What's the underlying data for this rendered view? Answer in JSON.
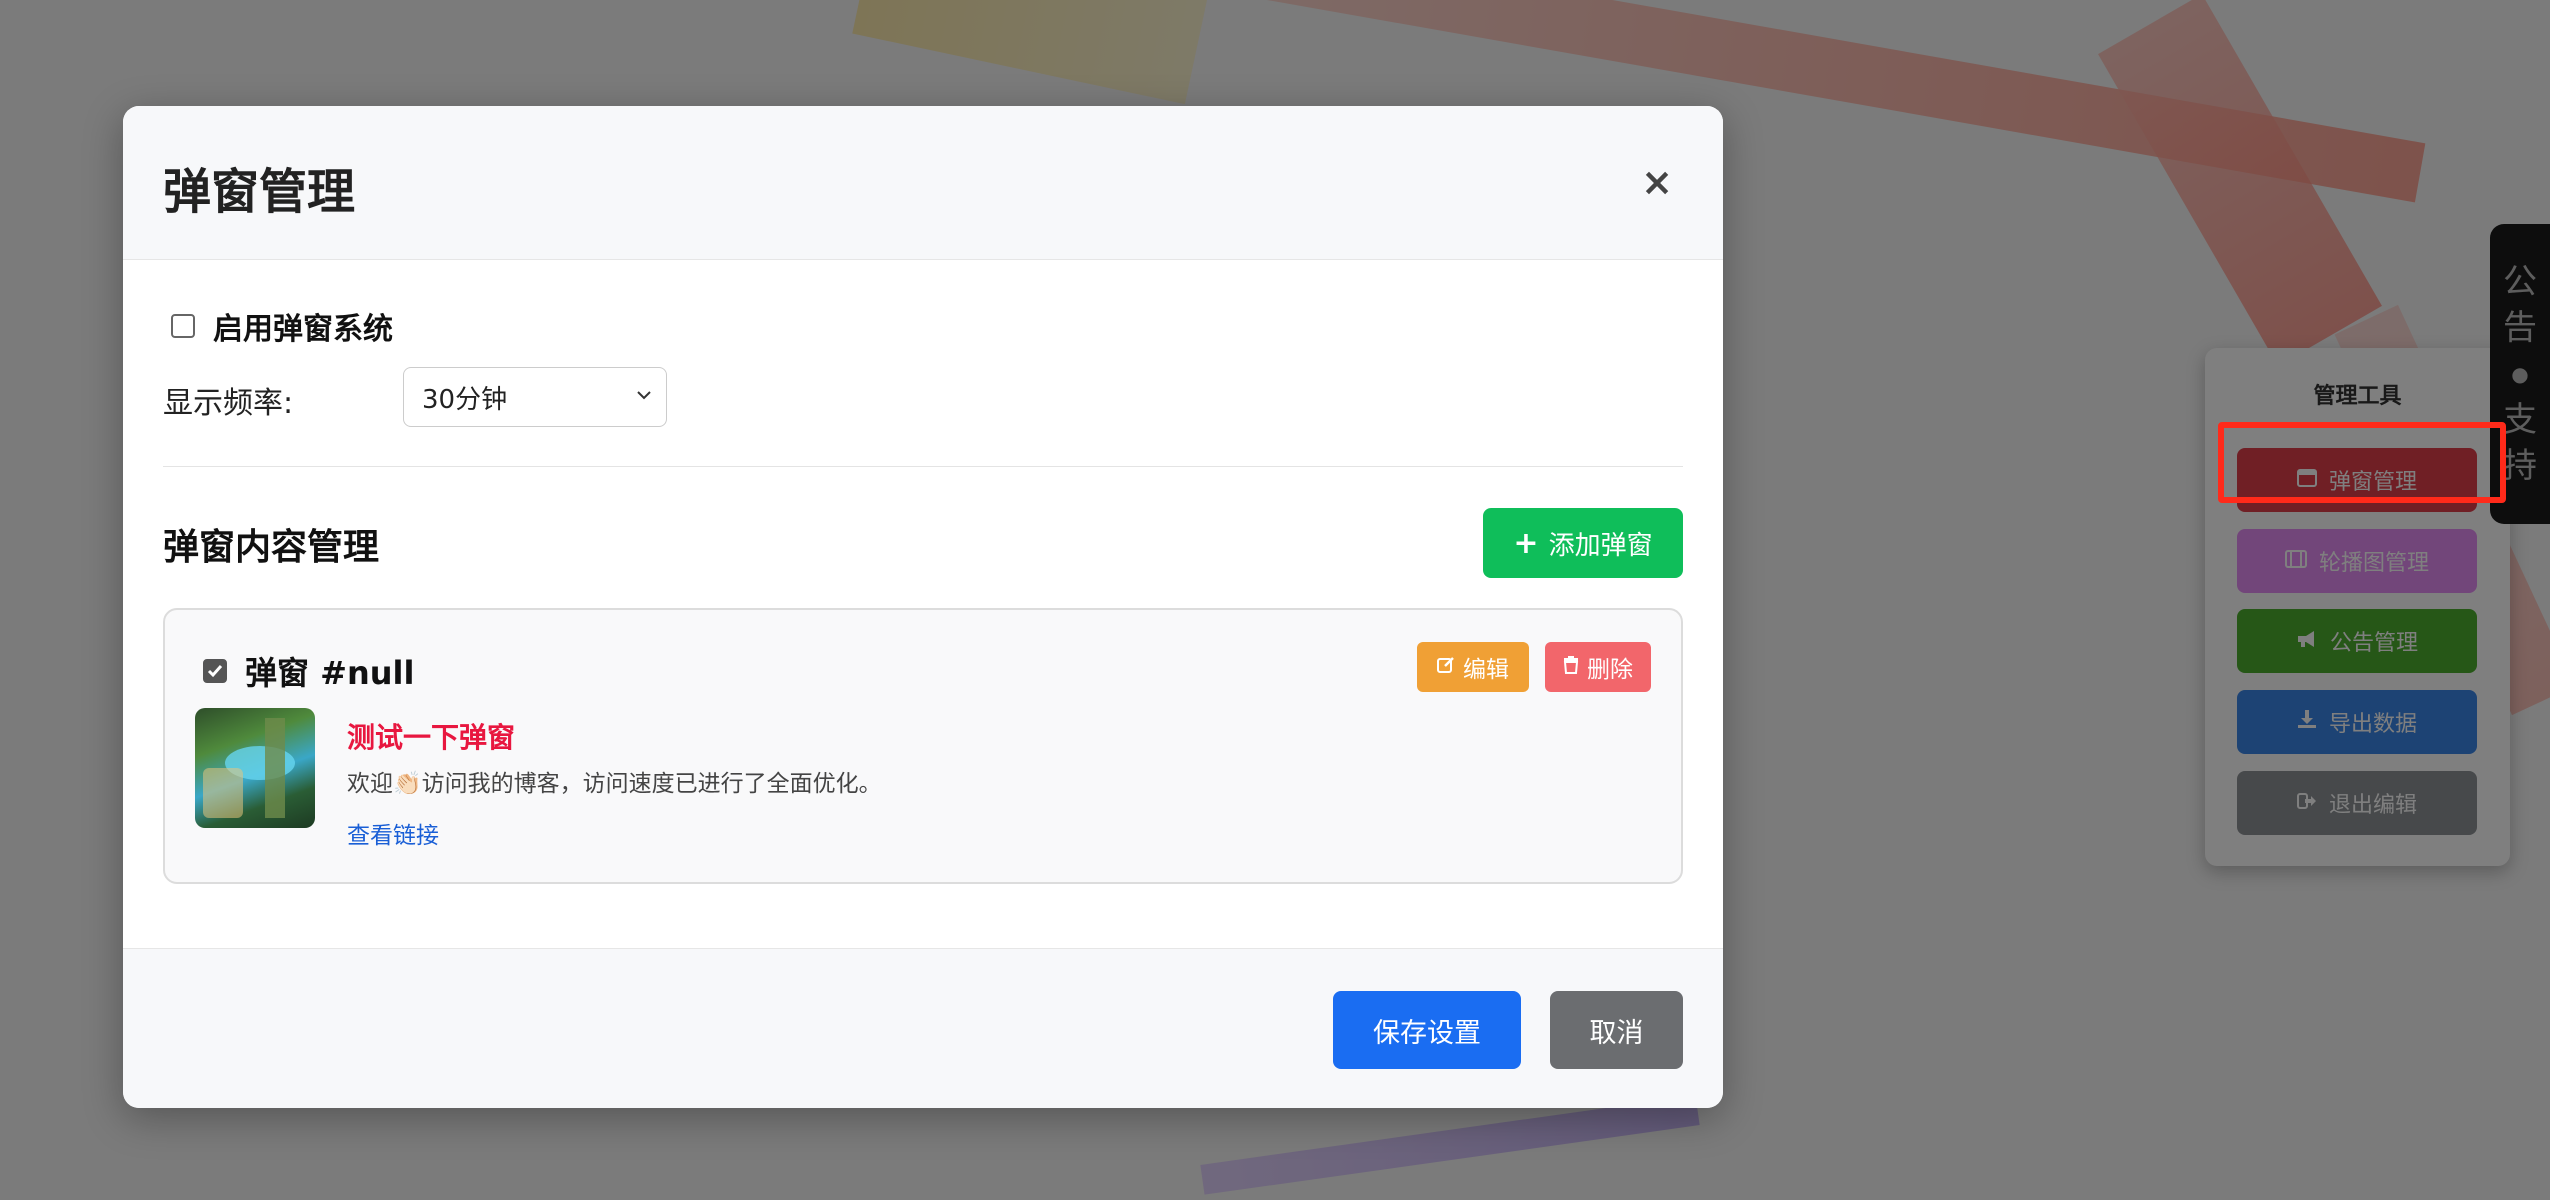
{
  "modal": {
    "title": "弹窗管理",
    "close_icon": "×",
    "enable_label": "启用弹窗系统",
    "enable_checked": false,
    "frequency_label": "显示频率:",
    "frequency_value": "30分钟",
    "section_title": "弹窗内容管理",
    "add_button": "添加弹窗",
    "card": {
      "title": "弹窗 #null",
      "checked": true,
      "edit_button": "编辑",
      "delete_button": "删除",
      "popup_title": "测试一下弹窗",
      "popup_desc": "欢迎👏🏻访问我的博客，访问速度已进行了全面优化。",
      "link_text": "查看链接"
    },
    "save_button": "保存设置",
    "cancel_button": "取消"
  },
  "tools": {
    "title": "管理工具",
    "items": [
      {
        "label": "弹窗管理",
        "icon": "window-icon",
        "color": "#e03e4b"
      },
      {
        "label": "轮播图管理",
        "icon": "film-icon",
        "color": "#e58cf5"
      },
      {
        "label": "公告管理",
        "icon": "megaphone-icon",
        "color": "#4caf2f"
      },
      {
        "label": "导出数据",
        "icon": "download-icon",
        "color": "#3a86e8"
      },
      {
        "label": "退出编辑",
        "icon": "signout-icon",
        "color": "#8e9296"
      }
    ]
  },
  "side_tab": {
    "chars": [
      "公",
      "告",
      "●",
      "支",
      "持"
    ]
  },
  "colors": {
    "highlight": "#ff2a1a",
    "primary": "#1a6df2",
    "success": "#0fbe5a"
  }
}
